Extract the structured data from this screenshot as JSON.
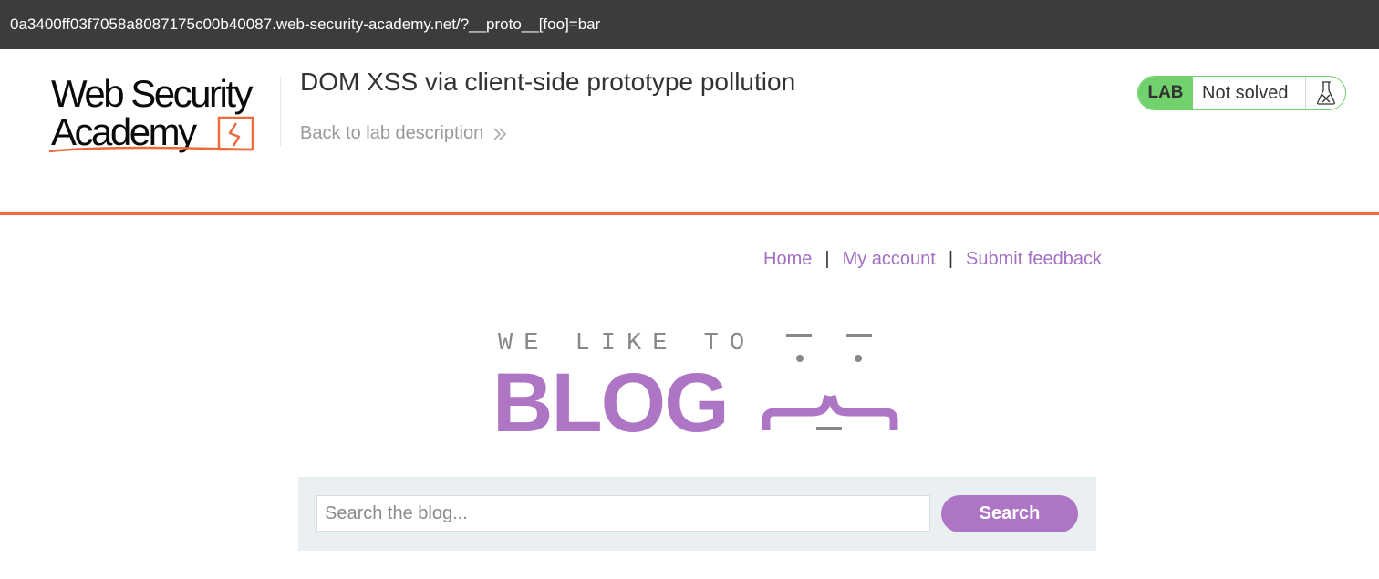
{
  "browser": {
    "url": "0a3400ff03f7058a8087175c00b40087.web-security-academy.net/?__proto__[foo]=bar"
  },
  "header": {
    "logo_line1": "Web Security",
    "logo_line2": "Academy",
    "lab_title": "DOM XSS via client-side prototype pollution",
    "back_link": "Back to lab description",
    "back_icon": "double-chevron-right",
    "lab_badge": "LAB",
    "lab_status": "Not solved",
    "status_icon": "flask-icon",
    "accent_color": "#ec6b3b",
    "status_color": "#70d16d"
  },
  "nav": {
    "home": "Home",
    "separator": "|",
    "my_account": "My account",
    "submit_feedback": "Submit feedback"
  },
  "banner": {
    "tagline": "WE LIKE TO",
    "word": "BLOG",
    "brand_color": "#ae75c5"
  },
  "search": {
    "placeholder": "Search the blog...",
    "value": "",
    "button_label": "Search"
  }
}
